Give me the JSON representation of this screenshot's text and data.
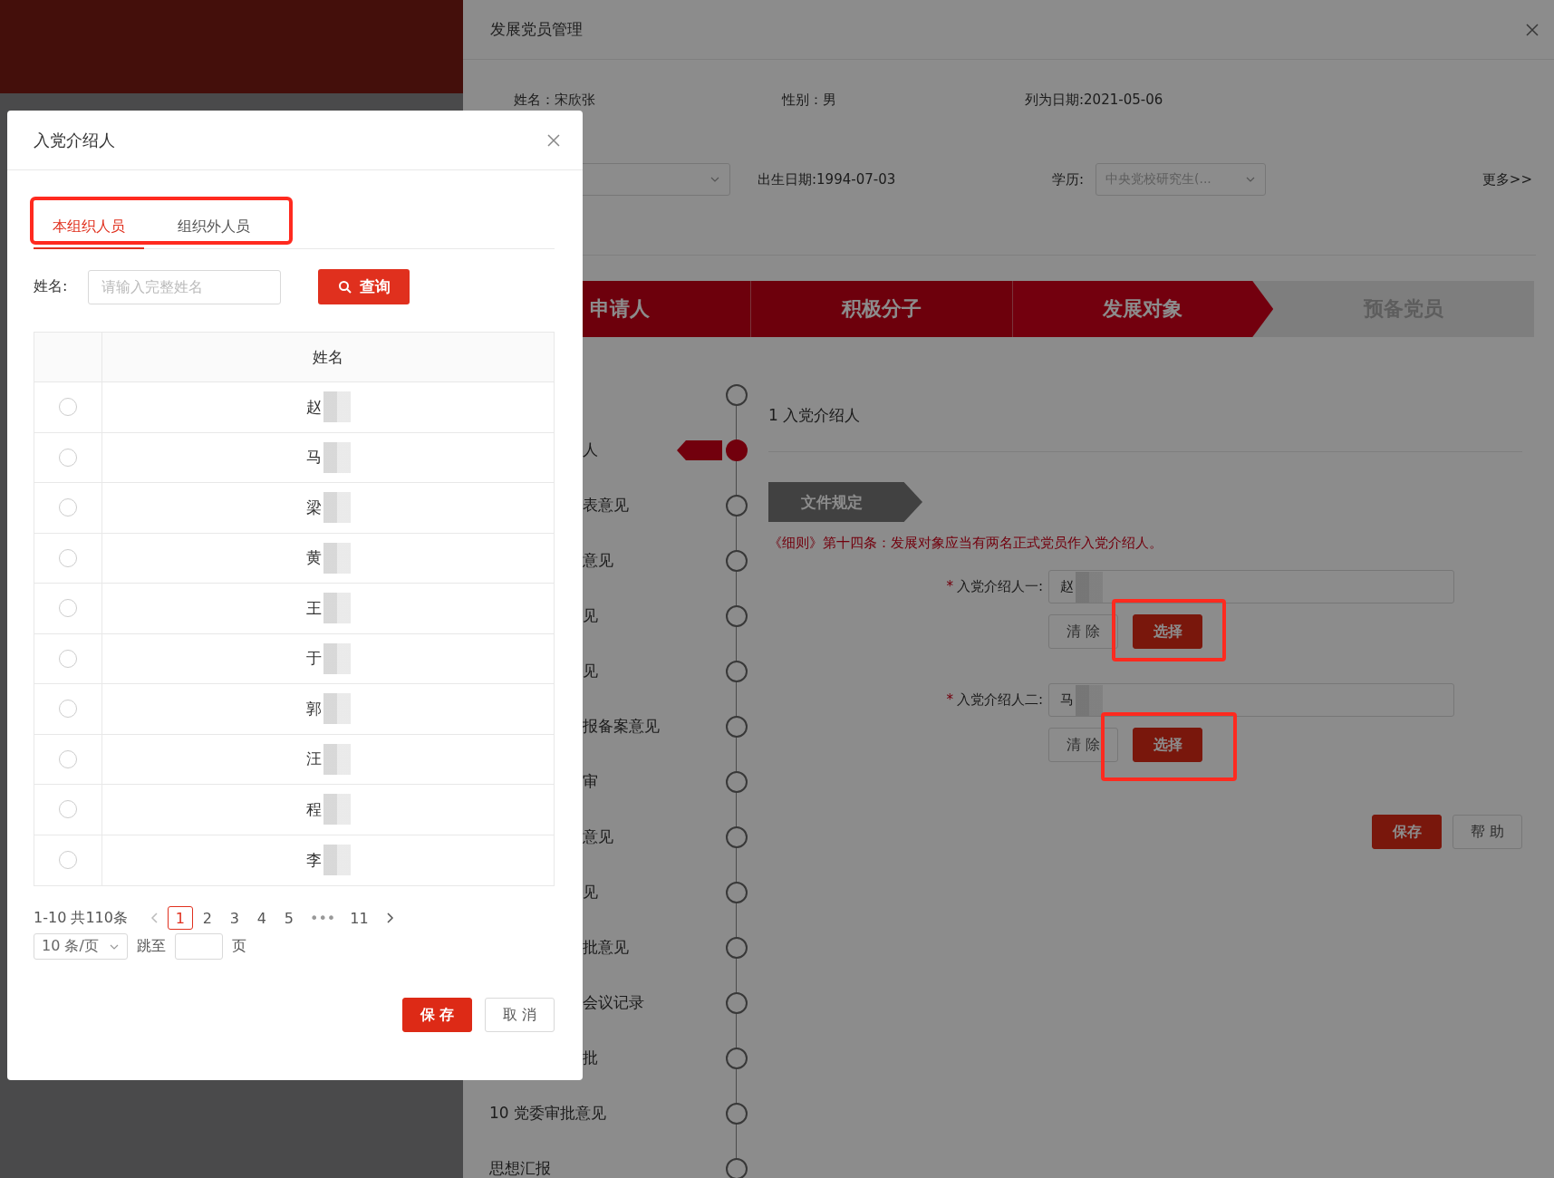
{
  "main_panel": {
    "title": "发展党员管理",
    "info_row_1": [
      {
        "label": "姓名：",
        "value": "宋欣张"
      },
      {
        "label": "性别：",
        "value": "男"
      },
      {
        "label": "列为日期:",
        "value": "2021-05-06"
      }
    ],
    "info_row_2": {
      "birth_label": "出生日期:",
      "birth_value": "1994-07-03",
      "education_label": "学历:",
      "education_value": "中央党校研究生(...",
      "more_link": "更多>>"
    },
    "steps": [
      {
        "label": "申请人",
        "completed": true,
        "selected": false
      },
      {
        "label": "积极分子",
        "completed": true,
        "selected": false
      },
      {
        "label": "发展对象",
        "completed": false,
        "selected": true
      },
      {
        "label": "预备党员",
        "completed": false,
        "selected": false
      }
    ],
    "timeline": [
      {
        "selected": false
      },
      {
        "label": "人",
        "partial": true,
        "selected": true
      },
      {
        "label": "表意见",
        "partial": true,
        "selected": false
      },
      {
        "label": "意见",
        "partial": true,
        "selected": false
      },
      {
        "label": "见",
        "partial": true,
        "selected": false
      },
      {
        "label": "见",
        "partial": true,
        "selected": false
      },
      {
        "label": "报备案意见",
        "partial": true,
        "selected": false
      },
      {
        "label": "审",
        "partial": true,
        "selected": false
      },
      {
        "label": "意见",
        "partial": true,
        "selected": false
      },
      {
        "label": "见",
        "partial": true,
        "selected": false
      },
      {
        "label": "批意见",
        "partial": true,
        "selected": false
      },
      {
        "label": "会议记录",
        "partial": true,
        "selected": false
      },
      {
        "label": "批",
        "partial": true,
        "selected": false
      },
      {
        "label": "10 党委审批意见",
        "partial": false,
        "selected": false
      },
      {
        "label": "思想汇报",
        "partial": false,
        "selected": false
      }
    ],
    "section_title": "1 入党介绍人",
    "rule_tag": "文件规定",
    "rule_text": "《细则》第十四条：发展对象应当有两名正式党员作入党介绍人。",
    "fields": [
      {
        "label": "入党介绍人一:",
        "required_mark": "*",
        "value": "赵",
        "clear_button": "清 除",
        "choose_button": "选择",
        "highlighted": true
      },
      {
        "label": "入党介绍人二:",
        "required_mark": "*",
        "value": "马",
        "clear_button": "清 除",
        "choose_button": "选择",
        "highlighted": true
      }
    ],
    "footer_buttons": [
      {
        "label": "保存",
        "kind": "primary"
      },
      {
        "label": "帮 助",
        "kind": "default"
      }
    ]
  },
  "modal": {
    "title": "入党介绍人",
    "tabs_highlighted": true,
    "tabs": [
      {
        "label": "本组织人员",
        "selected": true
      },
      {
        "label": "组织外人员",
        "selected": false
      }
    ],
    "search": {
      "label": "姓名:",
      "placeholder": "请输入完整姓名",
      "button": "查询"
    },
    "table": {
      "columns": [
        "姓名"
      ],
      "rows": [
        {
          "name": "赵",
          "selected": false
        },
        {
          "name": "马",
          "selected": false
        },
        {
          "name": "梁",
          "selected": false
        },
        {
          "name": "黄",
          "selected": false
        },
        {
          "name": "王",
          "selected": false
        },
        {
          "name": "于",
          "selected": false
        },
        {
          "name": "郭",
          "selected": false
        },
        {
          "name": "汪",
          "selected": false
        },
        {
          "name": "程",
          "selected": false
        },
        {
          "name": "李",
          "selected": false
        }
      ]
    },
    "pagination": {
      "summary": "1-10 共110条",
      "pages": [
        {
          "label": "1",
          "kind": "page",
          "selected": true
        },
        {
          "label": "2",
          "kind": "page",
          "selected": false
        },
        {
          "label": "3",
          "kind": "page",
          "selected": false
        },
        {
          "label": "4",
          "kind": "page",
          "selected": false
        },
        {
          "label": "5",
          "kind": "page",
          "selected": false
        },
        {
          "label": "•••",
          "kind": "ellipsis",
          "selected": false
        },
        {
          "label": "11",
          "kind": "page",
          "selected": false
        }
      ],
      "page_size": "10 条/页",
      "jump_label": "跳至",
      "jump_suffix": "页"
    },
    "footer_buttons": [
      {
        "label": "保 存",
        "kind": "primary"
      },
      {
        "label": "取 消",
        "kind": "default"
      }
    ]
  }
}
